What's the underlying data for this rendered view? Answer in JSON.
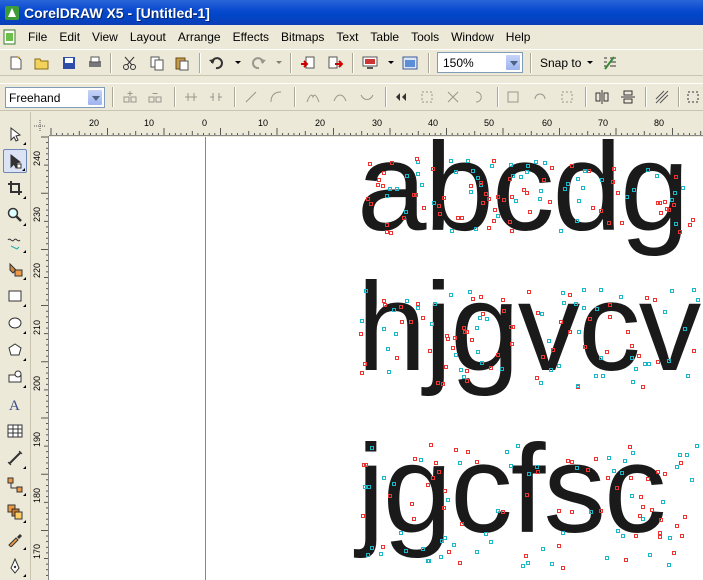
{
  "window": {
    "title": "CorelDRAW X5 - [Untitled-1]"
  },
  "menu": [
    {
      "label": "File"
    },
    {
      "label": "Edit"
    },
    {
      "label": "View"
    },
    {
      "label": "Layout"
    },
    {
      "label": "Arrange"
    },
    {
      "label": "Effects"
    },
    {
      "label": "Bitmaps"
    },
    {
      "label": "Text"
    },
    {
      "label": "Table"
    },
    {
      "label": "Tools"
    },
    {
      "label": "Window"
    },
    {
      "label": "Help"
    }
  ],
  "standard_toolbar": {
    "zoom_level": "150%",
    "snap_to_label": "Snap to"
  },
  "property_bar": {
    "tool_mode": "Freehand"
  },
  "rulers": {
    "horizontal_labels": [
      "20",
      "10",
      "0",
      "10",
      "20",
      "30",
      "40",
      "50",
      "60",
      "70",
      "80"
    ],
    "vertical_labels": [
      "240",
      "230",
      "220",
      "210",
      "200",
      "190",
      "180",
      "170"
    ]
  },
  "canvas": {
    "text_lines": [
      "abcdg",
      "hjgvcv",
      "jgcfsc"
    ]
  },
  "colors": {
    "titlebar_blue": "#0a4ad0",
    "node_red": "#e33333",
    "node_cyan": "#1ab7c9",
    "glyph_fill": "#1a1a1a"
  }
}
